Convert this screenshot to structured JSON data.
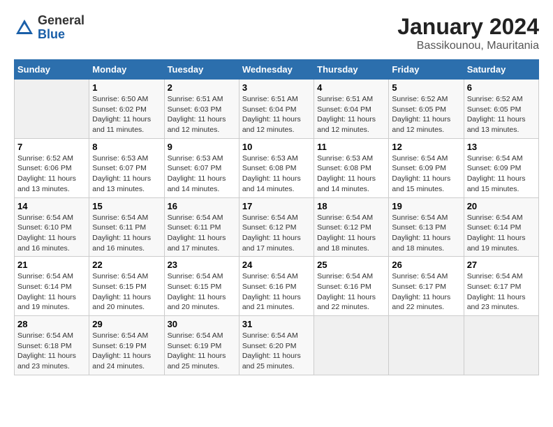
{
  "logo": {
    "general": "General",
    "blue": "Blue"
  },
  "header": {
    "month": "January 2024",
    "location": "Bassikounou, Mauritania"
  },
  "weekdays": [
    "Sunday",
    "Monday",
    "Tuesday",
    "Wednesday",
    "Thursday",
    "Friday",
    "Saturday"
  ],
  "weeks": [
    [
      {
        "day": "",
        "sunrise": "",
        "sunset": "",
        "daylight": ""
      },
      {
        "day": "1",
        "sunrise": "Sunrise: 6:50 AM",
        "sunset": "Sunset: 6:02 PM",
        "daylight": "Daylight: 11 hours and 11 minutes."
      },
      {
        "day": "2",
        "sunrise": "Sunrise: 6:51 AM",
        "sunset": "Sunset: 6:03 PM",
        "daylight": "Daylight: 11 hours and 12 minutes."
      },
      {
        "day": "3",
        "sunrise": "Sunrise: 6:51 AM",
        "sunset": "Sunset: 6:04 PM",
        "daylight": "Daylight: 11 hours and 12 minutes."
      },
      {
        "day": "4",
        "sunrise": "Sunrise: 6:51 AM",
        "sunset": "Sunset: 6:04 PM",
        "daylight": "Daylight: 11 hours and 12 minutes."
      },
      {
        "day": "5",
        "sunrise": "Sunrise: 6:52 AM",
        "sunset": "Sunset: 6:05 PM",
        "daylight": "Daylight: 11 hours and 12 minutes."
      },
      {
        "day": "6",
        "sunrise": "Sunrise: 6:52 AM",
        "sunset": "Sunset: 6:05 PM",
        "daylight": "Daylight: 11 hours and 13 minutes."
      }
    ],
    [
      {
        "day": "7",
        "sunrise": "Sunrise: 6:52 AM",
        "sunset": "Sunset: 6:06 PM",
        "daylight": "Daylight: 11 hours and 13 minutes."
      },
      {
        "day": "8",
        "sunrise": "Sunrise: 6:53 AM",
        "sunset": "Sunset: 6:07 PM",
        "daylight": "Daylight: 11 hours and 13 minutes."
      },
      {
        "day": "9",
        "sunrise": "Sunrise: 6:53 AM",
        "sunset": "Sunset: 6:07 PM",
        "daylight": "Daylight: 11 hours and 14 minutes."
      },
      {
        "day": "10",
        "sunrise": "Sunrise: 6:53 AM",
        "sunset": "Sunset: 6:08 PM",
        "daylight": "Daylight: 11 hours and 14 minutes."
      },
      {
        "day": "11",
        "sunrise": "Sunrise: 6:53 AM",
        "sunset": "Sunset: 6:08 PM",
        "daylight": "Daylight: 11 hours and 14 minutes."
      },
      {
        "day": "12",
        "sunrise": "Sunrise: 6:54 AM",
        "sunset": "Sunset: 6:09 PM",
        "daylight": "Daylight: 11 hours and 15 minutes."
      },
      {
        "day": "13",
        "sunrise": "Sunrise: 6:54 AM",
        "sunset": "Sunset: 6:09 PM",
        "daylight": "Daylight: 11 hours and 15 minutes."
      }
    ],
    [
      {
        "day": "14",
        "sunrise": "Sunrise: 6:54 AM",
        "sunset": "Sunset: 6:10 PM",
        "daylight": "Daylight: 11 hours and 16 minutes."
      },
      {
        "day": "15",
        "sunrise": "Sunrise: 6:54 AM",
        "sunset": "Sunset: 6:11 PM",
        "daylight": "Daylight: 11 hours and 16 minutes."
      },
      {
        "day": "16",
        "sunrise": "Sunrise: 6:54 AM",
        "sunset": "Sunset: 6:11 PM",
        "daylight": "Daylight: 11 hours and 17 minutes."
      },
      {
        "day": "17",
        "sunrise": "Sunrise: 6:54 AM",
        "sunset": "Sunset: 6:12 PM",
        "daylight": "Daylight: 11 hours and 17 minutes."
      },
      {
        "day": "18",
        "sunrise": "Sunrise: 6:54 AM",
        "sunset": "Sunset: 6:12 PM",
        "daylight": "Daylight: 11 hours and 18 minutes."
      },
      {
        "day": "19",
        "sunrise": "Sunrise: 6:54 AM",
        "sunset": "Sunset: 6:13 PM",
        "daylight": "Daylight: 11 hours and 18 minutes."
      },
      {
        "day": "20",
        "sunrise": "Sunrise: 6:54 AM",
        "sunset": "Sunset: 6:14 PM",
        "daylight": "Daylight: 11 hours and 19 minutes."
      }
    ],
    [
      {
        "day": "21",
        "sunrise": "Sunrise: 6:54 AM",
        "sunset": "Sunset: 6:14 PM",
        "daylight": "Daylight: 11 hours and 19 minutes."
      },
      {
        "day": "22",
        "sunrise": "Sunrise: 6:54 AM",
        "sunset": "Sunset: 6:15 PM",
        "daylight": "Daylight: 11 hours and 20 minutes."
      },
      {
        "day": "23",
        "sunrise": "Sunrise: 6:54 AM",
        "sunset": "Sunset: 6:15 PM",
        "daylight": "Daylight: 11 hours and 20 minutes."
      },
      {
        "day": "24",
        "sunrise": "Sunrise: 6:54 AM",
        "sunset": "Sunset: 6:16 PM",
        "daylight": "Daylight: 11 hours and 21 minutes."
      },
      {
        "day": "25",
        "sunrise": "Sunrise: 6:54 AM",
        "sunset": "Sunset: 6:16 PM",
        "daylight": "Daylight: 11 hours and 22 minutes."
      },
      {
        "day": "26",
        "sunrise": "Sunrise: 6:54 AM",
        "sunset": "Sunset: 6:17 PM",
        "daylight": "Daylight: 11 hours and 22 minutes."
      },
      {
        "day": "27",
        "sunrise": "Sunrise: 6:54 AM",
        "sunset": "Sunset: 6:17 PM",
        "daylight": "Daylight: 11 hours and 23 minutes."
      }
    ],
    [
      {
        "day": "28",
        "sunrise": "Sunrise: 6:54 AM",
        "sunset": "Sunset: 6:18 PM",
        "daylight": "Daylight: 11 hours and 23 minutes."
      },
      {
        "day": "29",
        "sunrise": "Sunrise: 6:54 AM",
        "sunset": "Sunset: 6:19 PM",
        "daylight": "Daylight: 11 hours and 24 minutes."
      },
      {
        "day": "30",
        "sunrise": "Sunrise: 6:54 AM",
        "sunset": "Sunset: 6:19 PM",
        "daylight": "Daylight: 11 hours and 25 minutes."
      },
      {
        "day": "31",
        "sunrise": "Sunrise: 6:54 AM",
        "sunset": "Sunset: 6:20 PM",
        "daylight": "Daylight: 11 hours and 25 minutes."
      },
      {
        "day": "",
        "sunrise": "",
        "sunset": "",
        "daylight": ""
      },
      {
        "day": "",
        "sunrise": "",
        "sunset": "",
        "daylight": ""
      },
      {
        "day": "",
        "sunrise": "",
        "sunset": "",
        "daylight": ""
      }
    ]
  ]
}
